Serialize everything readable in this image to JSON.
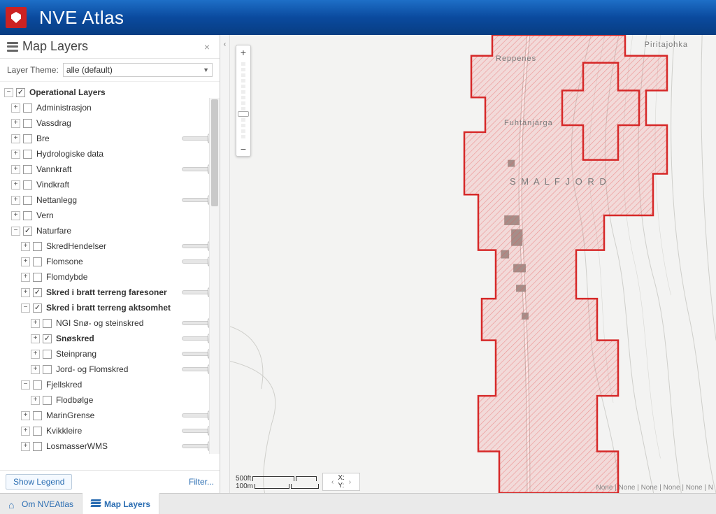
{
  "app": {
    "title": "NVE Atlas"
  },
  "panel": {
    "title": "Map Layers",
    "theme_label": "Layer Theme:",
    "theme_value": "alle (default)",
    "show_legend": "Show Legend",
    "filter": "Filter..."
  },
  "tree": {
    "root": {
      "label": "Operational Layers",
      "checked": true,
      "expanded": true,
      "bold": true
    },
    "items": [
      {
        "label": "Administrasjon",
        "checked": false,
        "expanded": false,
        "slider": false,
        "level": 1
      },
      {
        "label": "Vassdrag",
        "checked": false,
        "expanded": false,
        "slider": false,
        "level": 1
      },
      {
        "label": "Bre",
        "checked": false,
        "expanded": false,
        "slider": true,
        "level": 1
      },
      {
        "label": "Hydrologiske data",
        "checked": false,
        "expanded": false,
        "slider": false,
        "level": 1
      },
      {
        "label": "Vannkraft",
        "checked": false,
        "expanded": false,
        "slider": true,
        "level": 1
      },
      {
        "label": "Vindkraft",
        "checked": false,
        "expanded": false,
        "slider": false,
        "level": 1
      },
      {
        "label": "Nettanlegg",
        "checked": false,
        "expanded": false,
        "slider": true,
        "level": 1
      },
      {
        "label": "Vern",
        "checked": false,
        "expanded": false,
        "slider": false,
        "level": 1
      },
      {
        "label": "Naturfare",
        "checked": true,
        "expanded": true,
        "slider": false,
        "level": 1
      },
      {
        "label": "SkredHendelser",
        "checked": false,
        "expanded": false,
        "slider": true,
        "level": 2
      },
      {
        "label": "Flomsone",
        "checked": false,
        "expanded": false,
        "slider": true,
        "level": 2
      },
      {
        "label": "Flomdybde",
        "checked": false,
        "expanded": false,
        "slider": false,
        "level": 2
      },
      {
        "label": "Skred i bratt terreng faresoner",
        "checked": true,
        "expanded": false,
        "slider": true,
        "level": 2,
        "bold": true
      },
      {
        "label": "Skred i bratt terreng aktsomhet",
        "checked": true,
        "expanded": true,
        "slider": false,
        "level": 2,
        "bold": true
      },
      {
        "label": "NGI Snø- og steinskred",
        "checked": false,
        "expanded": false,
        "slider": true,
        "level": 3
      },
      {
        "label": "Snøskred",
        "checked": true,
        "expanded": false,
        "slider": true,
        "level": 3,
        "bold": true
      },
      {
        "label": "Steinprang",
        "checked": false,
        "expanded": false,
        "slider": true,
        "level": 3
      },
      {
        "label": "Jord- og Flomskred",
        "checked": false,
        "expanded": false,
        "slider": true,
        "level": 3
      },
      {
        "label": "Fjellskred",
        "checked": false,
        "expanded": true,
        "slider": false,
        "level": 2
      },
      {
        "label": "Flodbølge",
        "checked": false,
        "expanded": false,
        "slider": false,
        "level": 3
      },
      {
        "label": "MarinGrense",
        "checked": false,
        "expanded": false,
        "slider": true,
        "level": 2
      },
      {
        "label": "Kvikkleire",
        "checked": false,
        "expanded": false,
        "slider": true,
        "level": 2
      },
      {
        "label": "LosmasserWMS",
        "checked": false,
        "expanded": false,
        "slider": true,
        "level": 2
      }
    ]
  },
  "tabs": {
    "om": "Om NVEAtlas",
    "layers": "Map Layers"
  },
  "map": {
    "labels": {
      "reppenes": "Reppenes",
      "fuhtanjarga": "Fuhtánjárga",
      "smalfjord": "S M A L F J O R D",
      "piritajohka": "Piritajohka"
    },
    "scale": {
      "top": "500ft",
      "bottom": "100m"
    },
    "coord": {
      "x": "X:",
      "y": "Y:"
    },
    "attribution": "None | None | None | None | None | N"
  }
}
